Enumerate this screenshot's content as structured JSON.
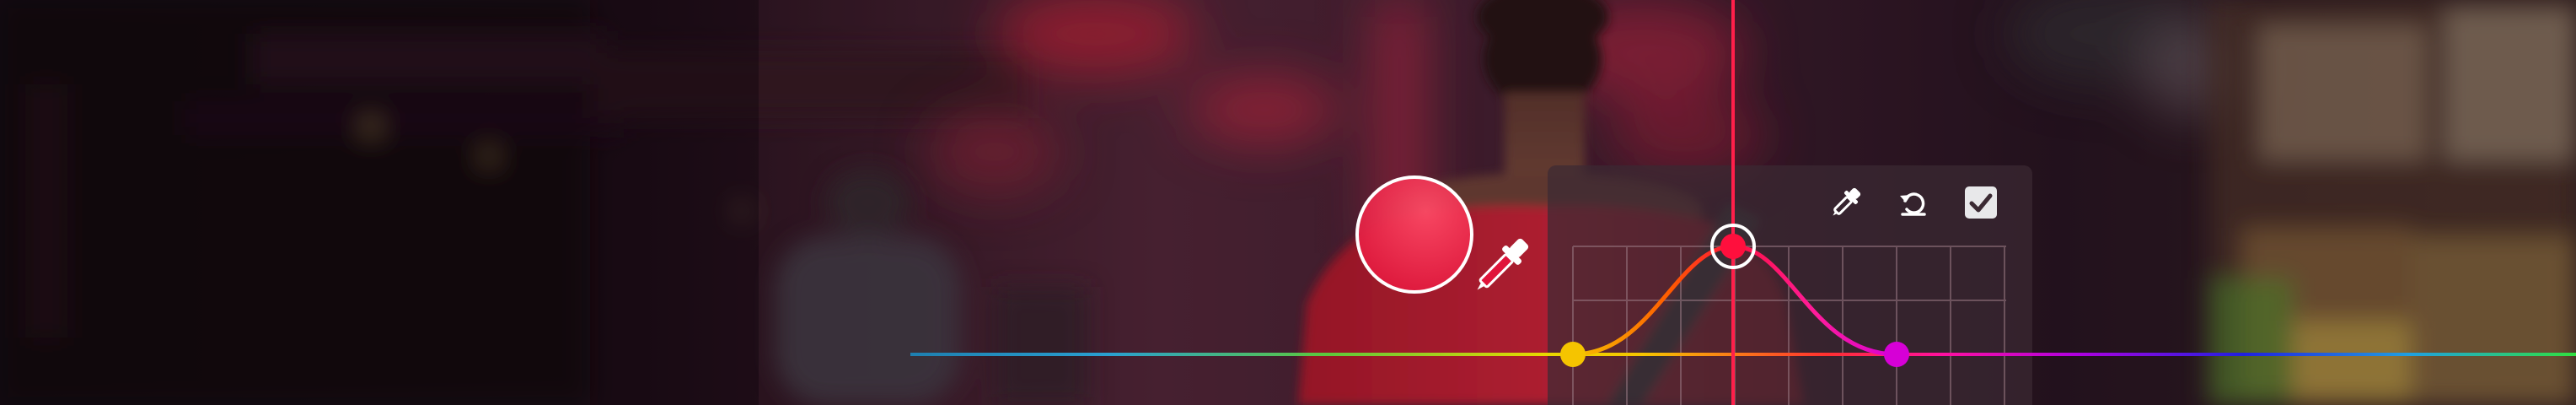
{
  "scene": {
    "background_description_colors": {
      "accent_red": "#ff1f4a",
      "shirt_red": "#e0283d",
      "panel_bg": "#3b2a33",
      "grid_line": "#8a6b74"
    }
  },
  "color_picker": {
    "sample_hue_color": "#ff1f4a",
    "eyedropper_icon": "eyedropper-icon"
  },
  "hue_curve": {
    "points": [
      {
        "name": "yellow",
        "color": "#f5c400"
      },
      {
        "name": "red",
        "color": "#ff0f3d"
      },
      {
        "name": "magenta",
        "color": "#d600d6"
      }
    ]
  },
  "panel": {
    "tools": [
      {
        "id": "eyedropper",
        "icon": "eyedropper-icon"
      },
      {
        "id": "reset",
        "icon": "reset-icon"
      },
      {
        "id": "confirm",
        "icon": "checkbox-icon"
      }
    ]
  }
}
